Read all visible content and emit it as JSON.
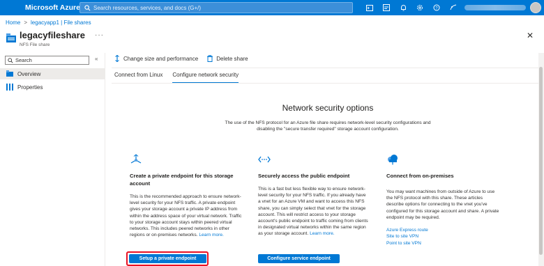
{
  "topbar": {
    "brand": "Microsoft Azure",
    "search_placeholder": "Search resources, services, and docs (G+/)",
    "icons": [
      "cloud-shell-icon",
      "directory-filter-icon",
      "notifications-icon",
      "settings-icon",
      "help-icon",
      "feedback-icon"
    ]
  },
  "breadcrumb": {
    "home": "Home",
    "sep": ">",
    "parent": "legacyapp1 | File shares"
  },
  "resource": {
    "title": "legacyfileshare",
    "subtitle": "NFS File share",
    "more": "···"
  },
  "sidebar": {
    "search_placeholder": "Search",
    "collapse": "«",
    "items": [
      {
        "label": "Overview",
        "active": true,
        "icon": "overview-icon"
      },
      {
        "label": "Properties",
        "active": false,
        "icon": "properties-icon"
      }
    ]
  },
  "toolbar": {
    "change_size": "Change size and performance",
    "delete_share": "Delete share"
  },
  "tabs": [
    {
      "label": "Connect from Linux",
      "active": false
    },
    {
      "label": "Configure network security",
      "active": true
    }
  ],
  "main": {
    "title": "Network security options",
    "description": "The use of the NFS protocol for an Azure file share requires network-level security configurations and disabling the \"secure transfer required\" storage account configuration."
  },
  "cards": [
    {
      "title": "Create a private endpoint for this storage account",
      "body": "This is the recommended approach to ensure network-level security for your NFS traffic. A private endpoint gives your storage account a private IP address from within the address space of your virtual network. Traffic to your storage account stays within peered virtual networks. This includes peered networks in other regions or on-premises networks.",
      "learn_more": "Learn more.",
      "button": "Setup a private endpoint"
    },
    {
      "title": "Securely access the public endpoint",
      "body": "This is a fast but less flexible way to ensure network-level security for your NFS traffic. If you already have a vnet for an Azure VM and want to access this NFS share, you can simply select that vnet for the storage account. This will restrict access to your storage account's public endpoint to traffic coming from clients in designated virtual networks within the same region as your storage account.",
      "learn_more": "Learn more.",
      "button": "Configure service endpoint"
    },
    {
      "title": "Connect from on-premises",
      "body": "You may want machines from outside of Azure to use the NFS protocol with this share. These articles describe options for connecting to the vnet you've configured for this storage account and share. A private endpoint may be required.",
      "links": [
        "Azure Express route",
        "Site to site VPN",
        "Point to site VPN"
      ]
    }
  ],
  "colors": {
    "accent": "#0078d4",
    "highlight": "#e81123"
  }
}
